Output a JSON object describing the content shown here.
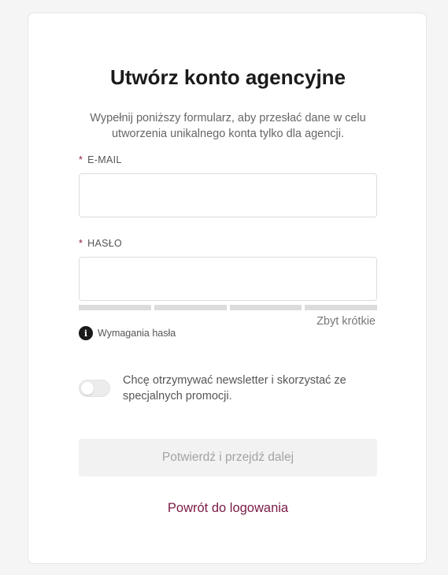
{
  "form": {
    "title": "Utwórz konto agencyjne",
    "subtitle": "Wypełnij poniższy formularz, aby przesłać dane w celu utworzenia unikalnego konta tylko dla agencji.",
    "required_marker": "*",
    "email": {
      "label": "E-MAIL",
      "value": "",
      "placeholder": ""
    },
    "password": {
      "label": "HASŁO",
      "value": "",
      "placeholder": "",
      "strength_text": "Zbyt krótkie",
      "strength_segments_filled": 0,
      "strength_segments_total": 4,
      "requirements_label": "Wymagania hasła",
      "requirements_icon": "info-icon"
    },
    "newsletter": {
      "label": "Chcę otrzymywać newsletter i skorzystać ze specjalnych promocji.",
      "checked": false
    },
    "submit_label": "Potwierdź i przejdź dalej",
    "back_link_label": "Powrót do logowania"
  },
  "colors": {
    "accent": "#7a1a45",
    "required": "#8b1d45",
    "disabled_button_bg": "#f2f2f2",
    "disabled_button_text": "#a3a3a3"
  }
}
